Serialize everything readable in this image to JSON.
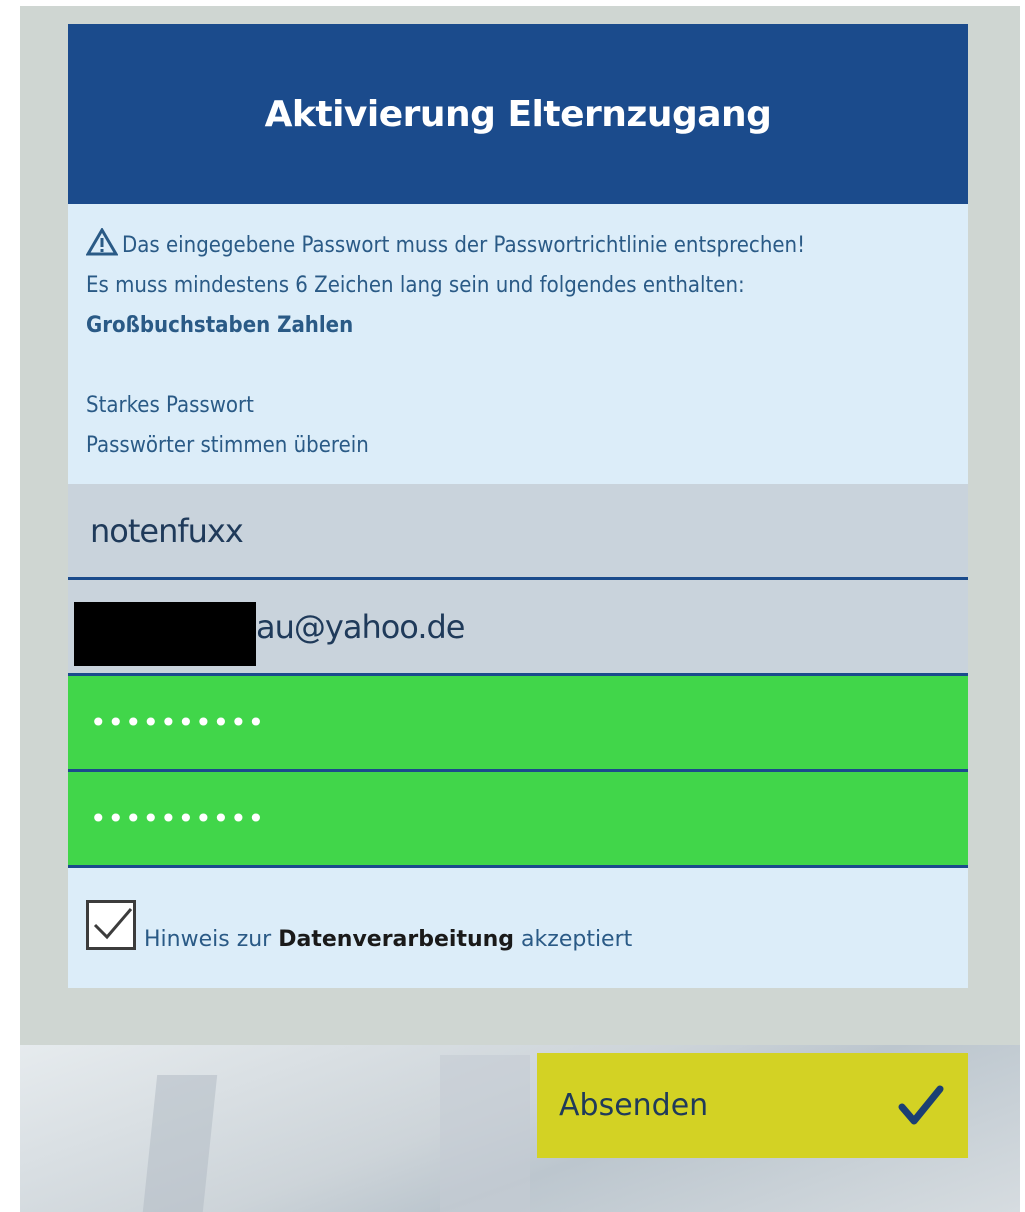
{
  "title": "Aktivierung Elternzugang",
  "notes": {
    "warning_line1": "Das eingegebene Passwort muss der Passwortrichtlinie entsprechen!",
    "warning_line2": "Es muss mindestens 6 Zeichen lang sein und folgendes enthalten:",
    "requirements": "Großbuchstaben Zahlen",
    "strength": "Starkes Passwort",
    "match": "Passwörter stimmen überein"
  },
  "form": {
    "username": "notenfuxx",
    "email_visible": "au@yahoo.de",
    "password_mask": "••••••••••",
    "password_confirm_mask": "••••••••••"
  },
  "consent": {
    "checked": true,
    "prefix": "Hinweis zur",
    "link": "Datenverarbeitung",
    "suffix": "akzeptiert"
  },
  "submit": {
    "label": "Absenden"
  },
  "colors": {
    "header": "#1b4b8c",
    "panel": "#dcedf9",
    "valid_field": "#41d64a",
    "submit": "#d3d224"
  },
  "icons": {
    "warning": "warning-triangle-icon",
    "check": "checkmark-icon"
  }
}
